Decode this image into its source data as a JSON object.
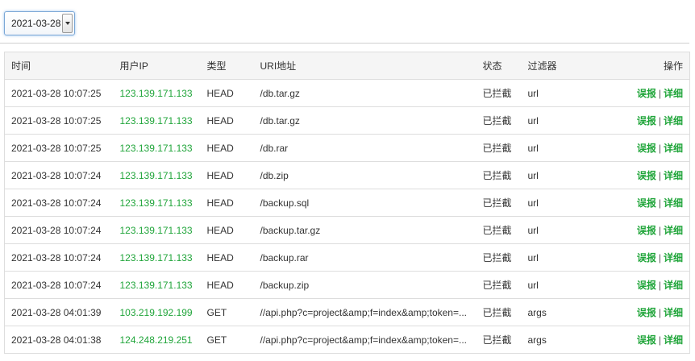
{
  "date_select": {
    "value": "2021-03-28"
  },
  "table": {
    "headers": [
      "时间",
      "用户IP",
      "类型",
      "URI地址",
      "状态",
      "过滤器",
      "操作"
    ],
    "rows": [
      {
        "time": "2021-03-28 10:07:25",
        "ip": "123.139.171.133",
        "method": "HEAD",
        "uri": "/db.tar.gz",
        "status": "已拦截",
        "filter": "url",
        "op1": "误报",
        "sep": "|",
        "op2": "详细"
      },
      {
        "time": "2021-03-28 10:07:25",
        "ip": "123.139.171.133",
        "method": "HEAD",
        "uri": "/db.tar.gz",
        "status": "已拦截",
        "filter": "url",
        "op1": "误报",
        "sep": "|",
        "op2": "详细"
      },
      {
        "time": "2021-03-28 10:07:25",
        "ip": "123.139.171.133",
        "method": "HEAD",
        "uri": "/db.rar",
        "status": "已拦截",
        "filter": "url",
        "op1": "误报",
        "sep": "|",
        "op2": "详细"
      },
      {
        "time": "2021-03-28 10:07:24",
        "ip": "123.139.171.133",
        "method": "HEAD",
        "uri": "/db.zip",
        "status": "已拦截",
        "filter": "url",
        "op1": "误报",
        "sep": "|",
        "op2": "详细"
      },
      {
        "time": "2021-03-28 10:07:24",
        "ip": "123.139.171.133",
        "method": "HEAD",
        "uri": "/backup.sql",
        "status": "已拦截",
        "filter": "url",
        "op1": "误报",
        "sep": "|",
        "op2": "详细"
      },
      {
        "time": "2021-03-28 10:07:24",
        "ip": "123.139.171.133",
        "method": "HEAD",
        "uri": "/backup.tar.gz",
        "status": "已拦截",
        "filter": "url",
        "op1": "误报",
        "sep": "|",
        "op2": "详细"
      },
      {
        "time": "2021-03-28 10:07:24",
        "ip": "123.139.171.133",
        "method": "HEAD",
        "uri": "/backup.rar",
        "status": "已拦截",
        "filter": "url",
        "op1": "误报",
        "sep": "|",
        "op2": "详细"
      },
      {
        "time": "2021-03-28 10:07:24",
        "ip": "123.139.171.133",
        "method": "HEAD",
        "uri": "/backup.zip",
        "status": "已拦截",
        "filter": "url",
        "op1": "误报",
        "sep": "|",
        "op2": "详细"
      },
      {
        "time": "2021-03-28 04:01:39",
        "ip": "103.219.192.199",
        "method": "GET",
        "uri": "//api.php?c=project&amp;f=index&amp;token=...",
        "status": "已拦截",
        "filter": "args",
        "op1": "误报",
        "sep": "|",
        "op2": "详细"
      },
      {
        "time": "2021-03-28 04:01:38",
        "ip": "124.248.219.251",
        "method": "GET",
        "uri": "//api.php?c=project&amp;f=index&amp;token=...",
        "status": "已拦截",
        "filter": "args",
        "op1": "误报",
        "sep": "|",
        "op2": "详细"
      }
    ]
  },
  "colors": {
    "accent_green": "#20a53a",
    "select_focus": "#7aa7d6"
  }
}
